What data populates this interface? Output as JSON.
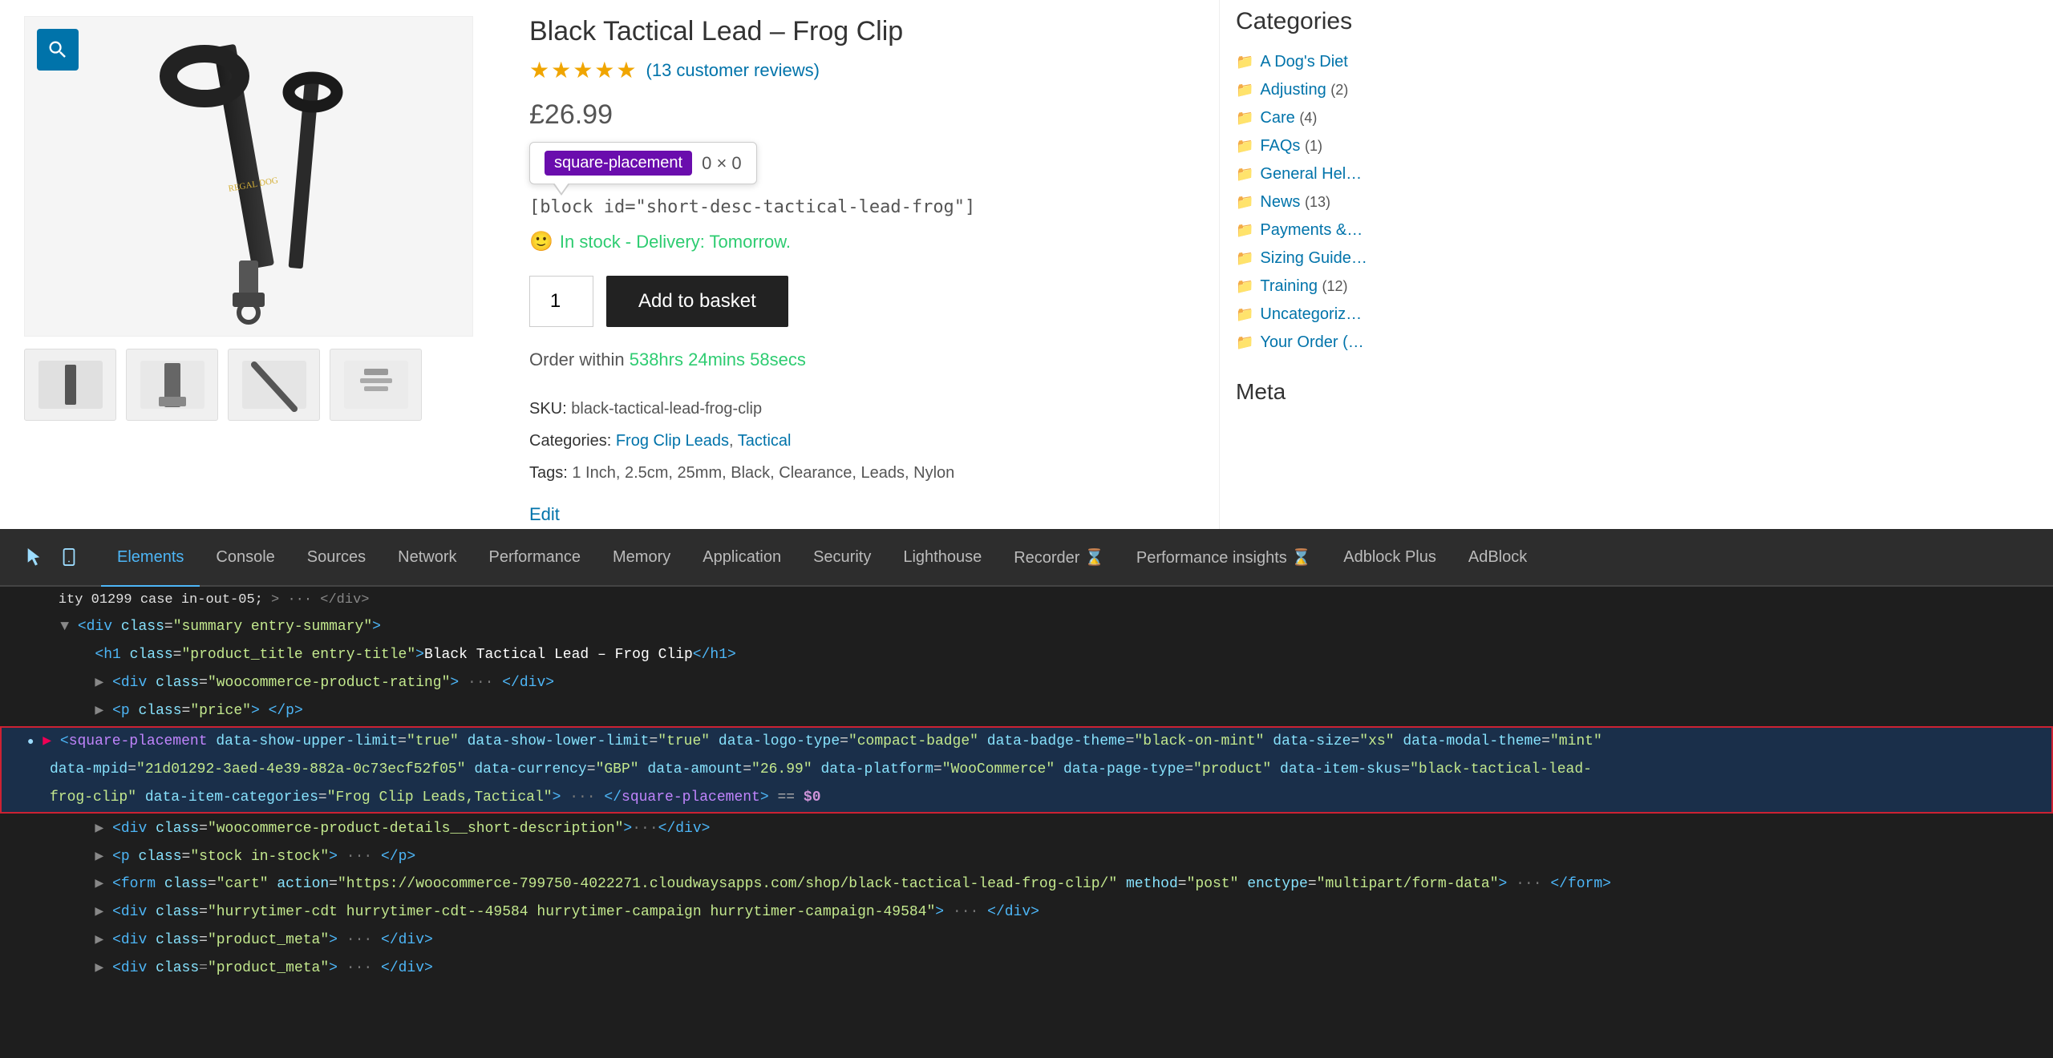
{
  "page": {
    "product": {
      "title": "Black Tactical Lead – Frog Clip",
      "price": "£26.99",
      "rating_stars": "★★★★★",
      "reviews_text": "(13 customer reviews)",
      "in_stock_text": "In stock - Delivery: Tomorrow.",
      "quantity": "1",
      "add_to_basket": "Add to basket",
      "order_within_prefix": "Order within",
      "order_time": "538hrs  24mins  58secs",
      "block_id_text": "[block id=\"short-desc-tactical-lead-frog\"]",
      "sku_label": "SKU:",
      "sku_value": "black-tactical-lead-frog-clip",
      "categories_label": "Categories:",
      "cat1": "Frog Clip Leads",
      "cat2": "Tactical",
      "tags_label": "Tags:",
      "tags": "1 Inch, 2.5cm, 25mm, Black, Clearance, Leads, Nylon",
      "edit_label": "Edit"
    },
    "tooltip": {
      "tag": "square-placement",
      "value": "0 × 0"
    },
    "sidebar": {
      "categories_title": "Categories",
      "items": [
        {
          "label": "A Dog's Diet",
          "count": ""
        },
        {
          "label": "Adjusting",
          "count": "(2)"
        },
        {
          "label": "Care",
          "count": "(4)"
        },
        {
          "label": "FAQs",
          "count": "(1)"
        },
        {
          "label": "General Hel…",
          "count": ""
        },
        {
          "label": "News",
          "count": "(13)"
        },
        {
          "label": "Payments &…",
          "count": ""
        },
        {
          "label": "Sizing Guide…",
          "count": ""
        },
        {
          "label": "Training",
          "count": "(12)"
        },
        {
          "label": "Uncategoriz…",
          "count": ""
        },
        {
          "label": "Your Order (…",
          "count": ""
        }
      ],
      "meta_title": "Meta"
    }
  },
  "devtools": {
    "tabs": [
      {
        "label": "Elements",
        "active": true
      },
      {
        "label": "Console",
        "active": false
      },
      {
        "label": "Sources",
        "active": false
      },
      {
        "label": "Network",
        "active": false
      },
      {
        "label": "Performance",
        "active": false
      },
      {
        "label": "Memory",
        "active": false
      },
      {
        "label": "Application",
        "active": false
      },
      {
        "label": "Security",
        "active": false
      },
      {
        "label": "Lighthouse",
        "active": false
      },
      {
        "label": "Recorder ⌛",
        "active": false
      },
      {
        "label": "Performance insights ⌛",
        "active": false
      },
      {
        "label": "Adblock Plus",
        "active": false
      },
      {
        "label": "AdBlock",
        "active": false
      }
    ],
    "code_lines": [
      {
        "text": "  <div class=\"summary entry-summary\">",
        "indent": 0,
        "type": "normal"
      },
      {
        "text": "    <h1 class=\"product_title entry-title\">Black Tactical Lead – Frog Clip</h1>",
        "indent": 0,
        "type": "normal"
      },
      {
        "text": "    ▶ <div class=\"woocommerce-product-rating\"> ··· </div>",
        "indent": 0,
        "type": "normal"
      },
      {
        "text": "    ▶ <p class=\"price\"> </p>",
        "indent": 0,
        "type": "normal"
      },
      {
        "text": "    ▶ <square-placement data-show-upper-limit=\"true\" data-show-lower-limit=\"true\" data-logo-type=\"compact-badge\" data-badge-theme=\"black-on-mint\" data-size=\"xs\" data-modal-theme=\"mint\"",
        "indent": 0,
        "type": "selected"
      },
      {
        "text": "        data-mpid=\"21d01292-3aed-4e39-882a-0c73ecf52f05\" data-currency=\"GBP\" data-amount=\"26.99\" data-platform=\"WooCommerce\" data-page-type=\"product\" data-item-skus=\"black-tactical-lead-",
        "indent": 0,
        "type": "selected-cont"
      },
      {
        "text": "        frog-clip\" data-item-categories=\"Frog Clip Leads,Tactical\"> ··· </square-placement> == $0",
        "indent": 0,
        "type": "selected-end"
      },
      {
        "text": "    ▶ <div class=\"woocommerce-product-details__short-description\"> ··· </div>",
        "indent": 0,
        "type": "normal"
      },
      {
        "text": "    ▶ <p class=\"stock in-stock\"> ··· </p>",
        "indent": 0,
        "type": "normal"
      },
      {
        "text": "    ▶ <form class=\"cart\" action=\"https://woocommerce-799750-4022271.cloudwaysapps.com/shop/black-tactical-lead-frog-clip/\" method=\"post\" enctype=\"multipart/form-data\"> ··· </form>",
        "indent": 0,
        "type": "normal"
      },
      {
        "text": "    ▶ <div class=\"hurrytimer-cdt hurrytimer-cdt--49584 hurrytimer-campaign hurrytimer-campaign-49584\"> ··· </div>",
        "indent": 0,
        "type": "normal"
      },
      {
        "text": "    ▶ <div class=\"product_meta\"> ··· </div>",
        "indent": 0,
        "type": "normal"
      }
    ]
  },
  "icons": {
    "magnify": "🔍",
    "folder": "📁",
    "cursor": "⬡",
    "mobile": "📱",
    "dots": "⋮",
    "chevron_right": "›"
  }
}
